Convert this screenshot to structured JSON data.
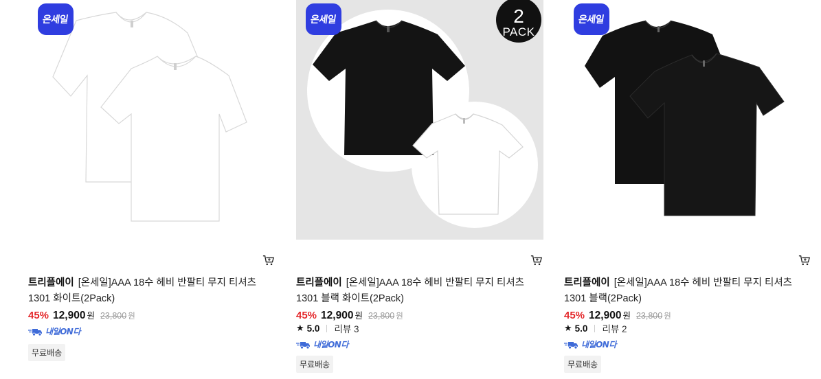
{
  "products": [
    {
      "badge": "온세일",
      "brand": "트리플에이",
      "title": "[온세일]AAA 18수 헤비 반팔티 무지 티셔츠 1301 화이트(2Pack)",
      "discount": "45%",
      "price": "12,900",
      "price_unit": "원",
      "original_price": "23,800",
      "original_unit": "원",
      "delivery": "내일ON다",
      "tag": "무료배송"
    },
    {
      "badge": "온세일",
      "pack_number": "2",
      "pack_text": "PACK",
      "brand": "트리플에이",
      "title": "[온세일]AAA 18수 헤비 반팔티 무지 티셔츠 1301 블랙 화이트(2Pack)",
      "discount": "45%",
      "price": "12,900",
      "price_unit": "원",
      "original_price": "23,800",
      "original_unit": "원",
      "rating": "5.0",
      "reviews": "리뷰 3",
      "delivery": "내일ON다",
      "tag": "무료배송"
    },
    {
      "badge": "온세일",
      "brand": "트리플에이",
      "title": "[온세일]AAA 18수 헤비 반팔티 무지 티셔츠 1301 블랙(2Pack)",
      "discount": "45%",
      "price": "12,900",
      "price_unit": "원",
      "original_price": "23,800",
      "original_unit": "원",
      "rating": "5.0",
      "reviews": "리뷰 2",
      "delivery": "내일ON다",
      "tag": "무료배송"
    }
  ],
  "colors": {
    "sale_badge": "#2f3de0",
    "discount": "#e4282b",
    "delivery": "#3f6bd8",
    "tag_bg": "#f2f2f2"
  },
  "icons": {
    "cart": "cart-icon",
    "star": "star-icon",
    "delivery": "truck-icon"
  }
}
